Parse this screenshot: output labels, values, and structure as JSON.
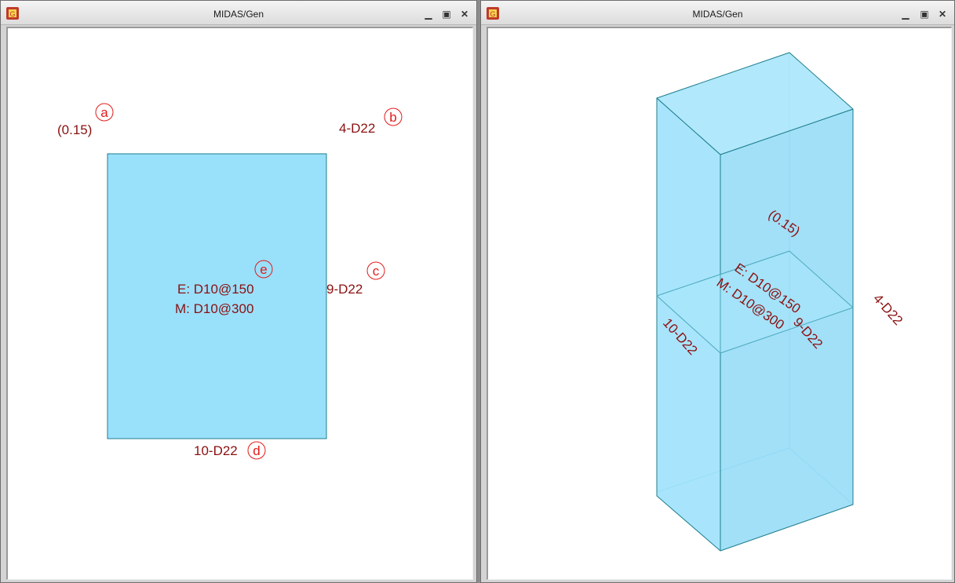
{
  "left_window": {
    "title": "MIDAS/Gen",
    "controls": {
      "minimize": "▁",
      "restore": "▣",
      "close": "✕"
    },
    "labels": {
      "cover": "(0.15)",
      "top_bars": "4-D22",
      "side_bars": "9-D22",
      "bottom_bars": "10-D22",
      "stirrup_e": "E: D10@150",
      "stirrup_m": "M: D10@300"
    },
    "markers": {
      "a": "a",
      "b": "b",
      "c": "c",
      "d": "d",
      "e": "e"
    }
  },
  "right_window": {
    "title": "MIDAS/Gen",
    "controls": {
      "minimize": "▁",
      "restore": "▣",
      "close": "✕"
    },
    "labels": {
      "cover": "(0.15)",
      "top_bars": "4-D22",
      "side_bars": "9-D22",
      "bottom_bars": "10-D22",
      "stirrup_e": "E: D10@150",
      "stirrup_m": "M: D10@300"
    }
  },
  "colors": {
    "section_fill": "#99e0fb",
    "section_stroke": "#1c7e8c",
    "label_text": "#8b1010",
    "marker": "#e31b1b"
  }
}
